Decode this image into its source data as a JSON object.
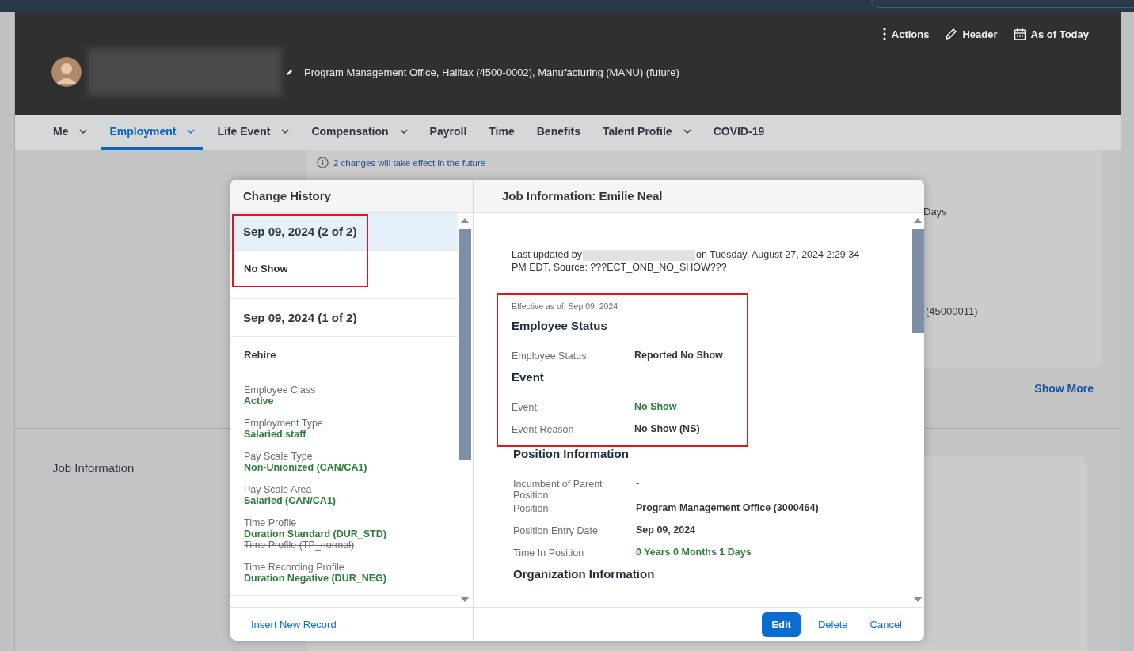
{
  "header": {
    "org_line": "Program Management Office, Halifax (4500-0002), Manufacturing (MANU) (future)",
    "actions": [
      {
        "kind": "more",
        "label": "Actions"
      },
      {
        "kind": "edit",
        "label": "Header"
      },
      {
        "kind": "calendar",
        "label": "As of Today"
      }
    ]
  },
  "tabs": [
    {
      "label": "Me",
      "has_menu": true,
      "selected": false
    },
    {
      "label": "Employment",
      "has_menu": true,
      "selected": true
    },
    {
      "label": "Life Event",
      "has_menu": true,
      "selected": false
    },
    {
      "label": "Compensation",
      "has_menu": true,
      "selected": false
    },
    {
      "label": "Payroll",
      "has_menu": false,
      "selected": false
    },
    {
      "label": "Time",
      "has_menu": false,
      "selected": false
    },
    {
      "label": "Benefits",
      "has_menu": false,
      "selected": false
    },
    {
      "label": "Talent Profile",
      "has_menu": true,
      "selected": false
    },
    {
      "label": "COVID-19",
      "has_menu": false,
      "selected": false
    }
  ],
  "background": {
    "notice": "2 changes will take effect in the future",
    "fragment_1": "Days",
    "fragment_2": "(45000011)",
    "show_more": "Show More",
    "section_label": "Job Information"
  },
  "dialog": {
    "history": {
      "title": "Change History",
      "entries": [
        {
          "date": "Sep 09, 2024 (2 of 2)",
          "selected": true,
          "highlighted": true,
          "event": "No Show"
        },
        {
          "date": "Sep 09, 2024 (1 of 2)",
          "selected": false,
          "highlighted": false,
          "event": "Rehire",
          "fields": [
            {
              "label": "Employee Class",
              "value": "Active"
            },
            {
              "label": "Employment Type",
              "value": "Salaried staff"
            },
            {
              "label": "Pay Scale Type",
              "value": "Non-Unionized (CAN/CA1)"
            },
            {
              "label": "Pay Scale Area",
              "value": "Salaried (CAN/CA1)"
            },
            {
              "label": "Time Profile",
              "value": "Duration Standard (DUR_STD)",
              "previous": "Time Profile (TP_normal)"
            },
            {
              "label": "Time Recording Profile",
              "value": "Duration Negative (DUR_NEG)"
            }
          ]
        }
      ],
      "footer_link": "Insert New Record"
    },
    "detail": {
      "title": "Job Information: Emilie Neal",
      "updated_prefix": "Last updated by",
      "updated_suffix": "on Tuesday, August 27, 2024 2:29:34 PM EDT. Source: ???ECT_ONB_NO_SHOW???",
      "blocks": [
        {
          "highlighted": true,
          "items": [
            {
              "kind": "effective",
              "text": "Effective as of: Sep 09, 2024"
            },
            {
              "kind": "heading",
              "text": "Employee Status"
            },
            {
              "kind": "field",
              "label": "Employee Status",
              "value": "Reported No Show",
              "changed": false
            },
            {
              "kind": "heading",
              "text": "Event"
            },
            {
              "kind": "field",
              "label": "Event",
              "value": "No Show",
              "changed": true
            },
            {
              "kind": "field",
              "label": "Event Reason",
              "value": "No Show (NS)",
              "changed": false
            }
          ]
        },
        {
          "highlighted": false,
          "items": [
            {
              "kind": "heading",
              "text": "Position Information"
            },
            {
              "kind": "field",
              "label": "Incumbent of Parent Position",
              "value": "-",
              "changed": false
            },
            {
              "kind": "field",
              "label": "Position",
              "value": "Program Management Office (3000464)",
              "changed": false
            },
            {
              "kind": "field",
              "label": "Position Entry Date",
              "value": "Sep 09, 2024",
              "changed": false
            },
            {
              "kind": "field",
              "label": "Time In Position",
              "value": "0 Years 0 Months 1 Days",
              "changed": true
            },
            {
              "kind": "heading",
              "text": "Organization Information"
            }
          ]
        }
      ],
      "buttons": [
        {
          "kind": "primary",
          "label": "Edit"
        },
        {
          "kind": "link",
          "label": "Delete"
        },
        {
          "kind": "link",
          "label": "Cancel"
        }
      ]
    }
  }
}
